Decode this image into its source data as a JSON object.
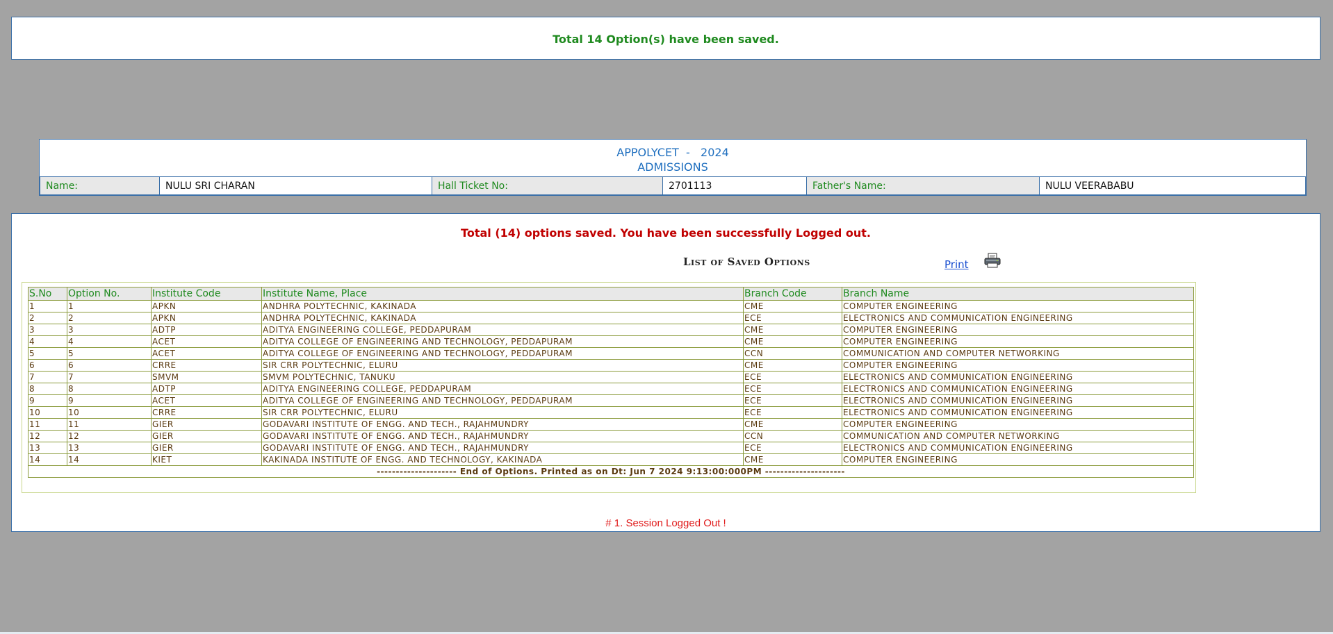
{
  "top_message": "Total 14 Option(s) have been saved.",
  "header": {
    "title": "APPOLYCET  -   2024",
    "subtitle": "ADMISSIONS",
    "name_label": "Name:",
    "name_value": "NULU SRI CHARAN",
    "hall_ticket_label": "Hall Ticket No:",
    "hall_ticket_value": "2701113",
    "father_label": "Father's Name:",
    "father_value": "NULU VEERABABU"
  },
  "main": {
    "logout_message": "Total (14) options saved. You have been successfully Logged out.",
    "list_title": "List of Saved Options",
    "print_label": "Print",
    "print_icon": "printer-icon",
    "columns": [
      "S.No",
      "Option No.",
      "Institute Code",
      "Institute Name, Place",
      "Branch Code",
      "Branch Name"
    ],
    "rows": [
      [
        "1",
        "1",
        "APKN",
        "ANDHRA POLYTECHNIC,  KAKINADA",
        "CME",
        "COMPUTER ENGINEERING"
      ],
      [
        "2",
        "2",
        "APKN",
        "ANDHRA POLYTECHNIC,  KAKINADA",
        "ECE",
        "ELECTRONICS AND COMMUNICATION ENGINEERING"
      ],
      [
        "3",
        "3",
        "ADTP",
        "ADITYA ENGINEERING COLLEGE,  PEDDAPURAM",
        "CME",
        "COMPUTER ENGINEERING"
      ],
      [
        "4",
        "4",
        "ACET",
        "ADITYA COLLEGE OF ENGINEERING AND TECHNOLOGY,  PEDDAPURAM",
        "CME",
        "COMPUTER ENGINEERING"
      ],
      [
        "5",
        "5",
        "ACET",
        "ADITYA COLLEGE OF ENGINEERING AND TECHNOLOGY,  PEDDAPURAM",
        "CCN",
        "COMMUNICATION AND COMPUTER NETWORKING"
      ],
      [
        "6",
        "6",
        "CRRE",
        "SIR CRR POLYTECHNIC,  ELURU",
        "CME",
        "COMPUTER ENGINEERING"
      ],
      [
        "7",
        "7",
        "SMVM",
        "SMVM POLYTECHNIC,  TANUKU",
        "ECE",
        "ELECTRONICS AND COMMUNICATION ENGINEERING"
      ],
      [
        "8",
        "8",
        "ADTP",
        "ADITYA ENGINEERING COLLEGE,  PEDDAPURAM",
        "ECE",
        "ELECTRONICS AND COMMUNICATION ENGINEERING"
      ],
      [
        "9",
        "9",
        "ACET",
        "ADITYA COLLEGE OF ENGINEERING AND TECHNOLOGY,  PEDDAPURAM",
        "ECE",
        "ELECTRONICS AND COMMUNICATION ENGINEERING"
      ],
      [
        "10",
        "10",
        "CRRE",
        "SIR CRR POLYTECHNIC,  ELURU",
        "ECE",
        "ELECTRONICS AND COMMUNICATION ENGINEERING"
      ],
      [
        "11",
        "11",
        "GIER",
        "GODAVARI INSTITUTE OF ENGG. AND TECH.,  RAJAHMUNDRY",
        "CME",
        "COMPUTER ENGINEERING"
      ],
      [
        "12",
        "12",
        "GIER",
        "GODAVARI INSTITUTE OF ENGG. AND TECH.,  RAJAHMUNDRY",
        "CCN",
        "COMMUNICATION AND COMPUTER NETWORKING"
      ],
      [
        "13",
        "13",
        "GIER",
        "GODAVARI INSTITUTE OF ENGG. AND TECH.,  RAJAHMUNDRY",
        "ECE",
        "ELECTRONICS AND COMMUNICATION ENGINEERING"
      ],
      [
        "14",
        "14",
        "KIET",
        "KAKINADA INSTITUTE OF ENGG. AND TECHNOLOGY,  KAKINADA",
        "CME",
        "COMPUTER ENGINEERING"
      ]
    ],
    "footer": "--------------------- End of Options. Printed as on Dt: Jun 7 2024 9:13:00:000PM ---------------------",
    "session_message": "# 1. Session Logged Out !"
  },
  "colors": {
    "background": "#a3a3a3",
    "border": "#3a6fa8",
    "success": "#1f8a1f",
    "error": "#c00000",
    "title_blue": "#1f6fbf",
    "cell_text": "#5a3a10"
  }
}
